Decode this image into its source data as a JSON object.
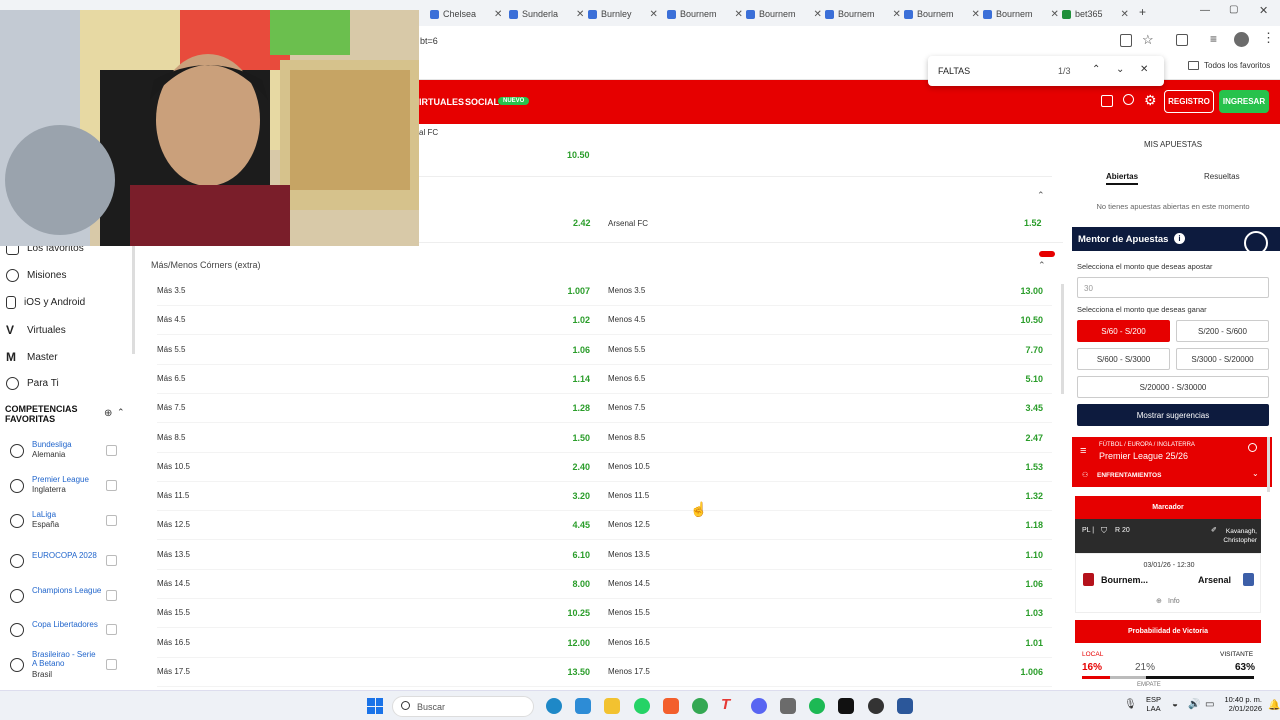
{
  "tabs": [
    {
      "label": "Chelsea",
      "x": 0
    },
    {
      "label": "Sunderla",
      "x": 1
    },
    {
      "label": "Burnley",
      "x": 2
    },
    {
      "label": "Bournem",
      "x": 3
    },
    {
      "label": "Bournem",
      "x": 4
    },
    {
      "label": "Bournem",
      "x": 5
    },
    {
      "label": "Bournem",
      "x": 6
    },
    {
      "label": "Bournem",
      "x": 7
    },
    {
      "label": "bet365",
      "x": 8
    }
  ],
  "address": {
    "url_fragment": "bt=6"
  },
  "bookmarks": {
    "all_label": "Todos los favoritos"
  },
  "find": {
    "query": "FALTAS",
    "count": "1/3"
  },
  "header": {
    "nav_virtuales": "IRTUALES",
    "nav_social": "SOCIAL",
    "badge_nuevo": "NUEVO",
    "registro": "REGISTRO",
    "ingresar": "INGRESAR"
  },
  "sidebar": {
    "items": [
      {
        "label": "Los favoritos"
      },
      {
        "label": "Misiones"
      },
      {
        "label": "iOS y Android"
      },
      {
        "label": "Virtuales"
      },
      {
        "label": "Master"
      },
      {
        "label": "Para Ti"
      }
    ],
    "competitions_title": "COMPETENCIAS FAVORITAS",
    "competitions": [
      {
        "name": "Bundesliga",
        "sub": "Alemania"
      },
      {
        "name": "Premier League",
        "sub": "Inglaterra"
      },
      {
        "name": "LaLiga",
        "sub": "España"
      },
      {
        "name": "EUROCOPA 2028",
        "sub": ""
      },
      {
        "name": "Champions League",
        "sub": ""
      },
      {
        "name": "Copa Libertadores",
        "sub": ""
      },
      {
        "name": "Brasileirao - Serie A Betano",
        "sub": "Brasil"
      }
    ]
  },
  "main": {
    "top_label": "al FC",
    "top_odd": "10.50",
    "row2_left_odd": "2.42",
    "row2_right_label": "Arsenal FC",
    "row2_right_odd": "1.52",
    "section_title": "Más/Menos Córners (extra)",
    "rows": [
      {
        "over": "Más 3.5",
        "over_odd": "1.007",
        "under": "Menos 3.5",
        "under_odd": "13.00"
      },
      {
        "over": "Más 4.5",
        "over_odd": "1.02",
        "under": "Menos 4.5",
        "under_odd": "10.50"
      },
      {
        "over": "Más 5.5",
        "over_odd": "1.06",
        "under": "Menos 5.5",
        "under_odd": "7.70"
      },
      {
        "over": "Más 6.5",
        "over_odd": "1.14",
        "under": "Menos 6.5",
        "under_odd": "5.10"
      },
      {
        "over": "Más 7.5",
        "over_odd": "1.28",
        "under": "Menos 7.5",
        "under_odd": "3.45"
      },
      {
        "over": "Más 8.5",
        "over_odd": "1.50",
        "under": "Menos 8.5",
        "under_odd": "2.47"
      },
      {
        "over": "Más 10.5",
        "over_odd": "2.40",
        "under": "Menos 10.5",
        "under_odd": "1.53"
      },
      {
        "over": "Más 11.5",
        "over_odd": "3.20",
        "under": "Menos 11.5",
        "under_odd": "1.32"
      },
      {
        "over": "Más 12.5",
        "over_odd": "4.45",
        "under": "Menos 12.5",
        "under_odd": "1.18"
      },
      {
        "over": "Más 13.5",
        "over_odd": "6.10",
        "under": "Menos 13.5",
        "under_odd": "1.10"
      },
      {
        "over": "Más 14.5",
        "over_odd": "8.00",
        "under": "Menos 14.5",
        "under_odd": "1.06"
      },
      {
        "over": "Más 15.5",
        "over_odd": "10.25",
        "under": "Menos 15.5",
        "under_odd": "1.03"
      },
      {
        "over": "Más 16.5",
        "over_odd": "12.00",
        "under": "Menos 16.5",
        "under_odd": "1.01"
      },
      {
        "over": "Más 17.5",
        "over_odd": "13.50",
        "under": "Menos 17.5",
        "under_odd": "1.006"
      }
    ]
  },
  "right": {
    "mis_apuestas": "MIS APUESTAS",
    "tab_abiertas": "Abiertas",
    "tab_resueltas": "Resueltas",
    "empty_msg": "No tienes apuestas abiertas en este momento",
    "mentor_title": "Mentor de Apuestas",
    "amount_label": "Selecciona el monto que deseas apostar",
    "amount_value": "30",
    "win_label": "Selecciona el monto que deseas ganar",
    "ranges": [
      "S/60 - S/200",
      "S/200 - S/600",
      "S/600 - S/3000",
      "S/3000 - S/20000",
      "S/20000 - S/30000"
    ],
    "show_btn": "Mostrar sugerencias",
    "breadcrumb": "FÚTBOL / EUROPA / INGLATERRA",
    "league": "Premier League 25/26",
    "enfrentamientos": "ENFRENTAMIENTOS",
    "marcador": "Marcador",
    "pl": "PL |",
    "round": "R 20",
    "referee": "Kavanagh, Christopher",
    "datetime": "03/01/26 - 12:30",
    "home": "Bournem...",
    "away": "Arsenal",
    "info": "Info",
    "prob_title": "Probabilidad de Victoria",
    "local_label": "LOCAL",
    "visitante_label": "VISITANTE",
    "local_pct": "16%",
    "draw_pct": "21%",
    "away_pct": "63%",
    "empate": "EMPATE"
  },
  "taskbar": {
    "search": "Buscar",
    "lang1": "ESP",
    "lang2": "LAA",
    "time": "10:40 p. m.",
    "date": "2/01/2026"
  }
}
